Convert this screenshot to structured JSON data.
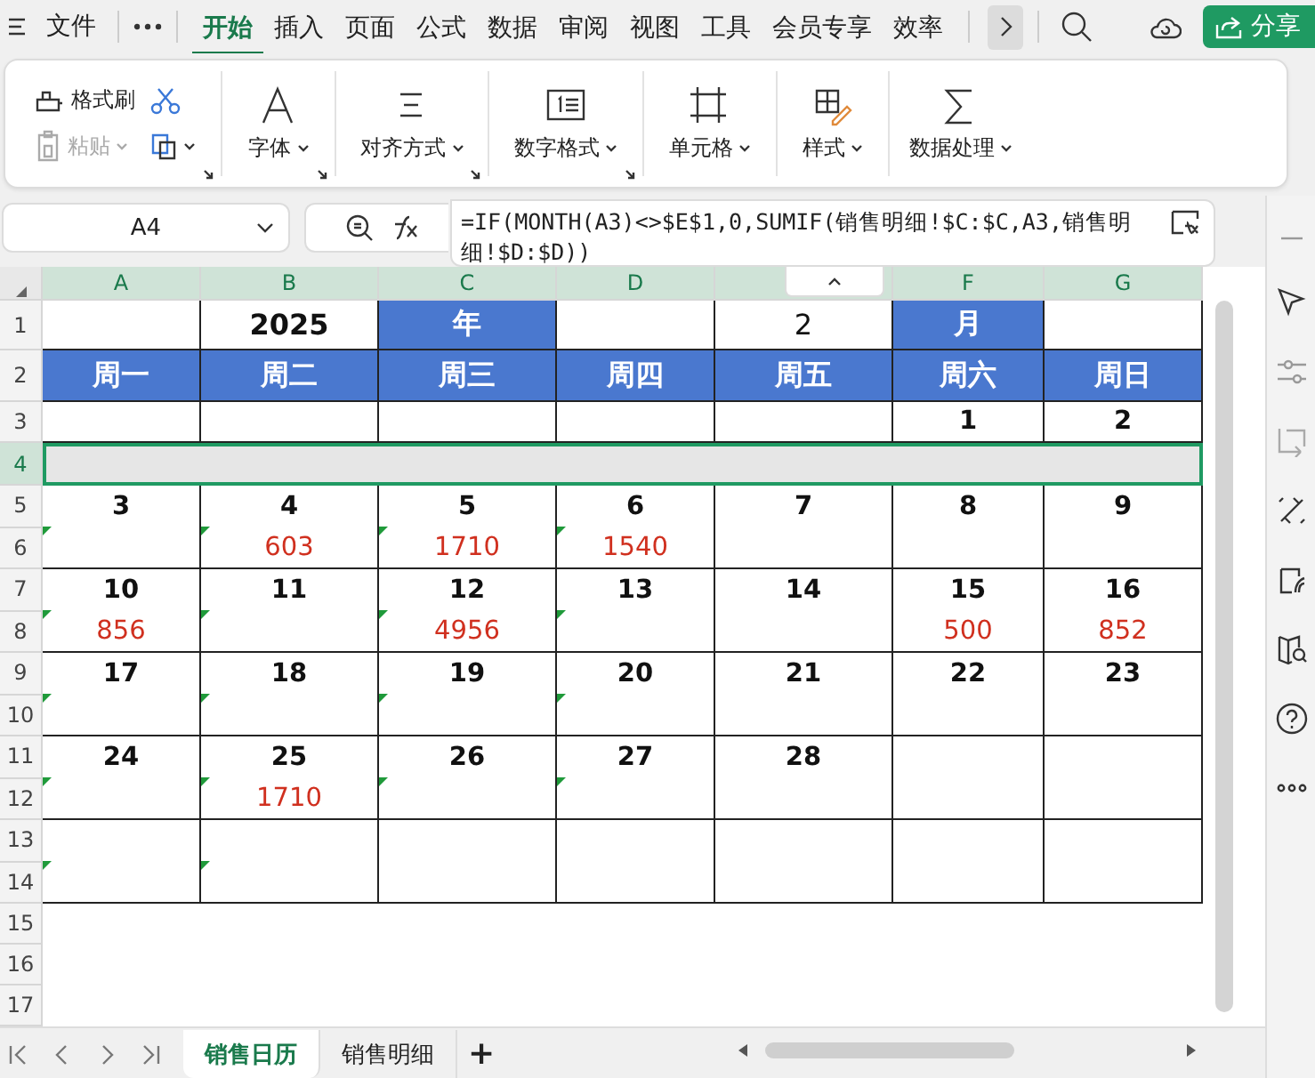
{
  "menubar": {
    "file": "文件",
    "tabs": [
      {
        "label": "开始",
        "selected": true
      },
      {
        "label": "插入",
        "selected": false
      },
      {
        "label": "页面",
        "selected": false
      },
      {
        "label": "公式",
        "selected": false
      },
      {
        "label": "数据",
        "selected": false
      },
      {
        "label": "审阅",
        "selected": false
      },
      {
        "label": "视图",
        "selected": false
      },
      {
        "label": "工具",
        "selected": false
      },
      {
        "label": "会员专享",
        "selected": false
      },
      {
        "label": "效率",
        "selected": false
      }
    ],
    "share": "分享"
  },
  "ribbon": {
    "format_painter": "格式刷",
    "paste": {
      "label": "粘贴",
      "disabled": true
    },
    "groups": [
      {
        "kind": "font",
        "label": "字体",
        "launcher": true
      },
      {
        "kind": "align",
        "label": "对齐方式",
        "launcher": true
      },
      {
        "kind": "number",
        "label": "数字格式",
        "launcher": true
      },
      {
        "kind": "cell",
        "label": "单元格",
        "launcher": false
      },
      {
        "kind": "style",
        "label": "样式",
        "launcher": false
      },
      {
        "kind": "sum",
        "label": "数据处理",
        "launcher": false
      }
    ]
  },
  "formula_bar": {
    "cell": "A4",
    "formula": "=IF(MONTH(A3)<>$E$1,0,SUMIF(销售明细!$C:$C,A3,销售明细!$D:$D))"
  },
  "sheet": {
    "columns": [
      {
        "kind": "header",
        "label": "A"
      },
      {
        "kind": "header",
        "label": "B"
      },
      {
        "kind": "header",
        "label": "C"
      },
      {
        "kind": "header",
        "label": "D"
      },
      {
        "kind": "collapse"
      },
      {
        "kind": "header",
        "label": "F"
      },
      {
        "kind": "header",
        "label": "G"
      }
    ],
    "rows": [
      {
        "label": "1",
        "selected": false
      },
      {
        "label": "2",
        "selected": false
      },
      {
        "label": "3",
        "selected": false
      },
      {
        "label": "4",
        "selected": true
      },
      {
        "label": "5",
        "selected": false
      },
      {
        "label": "6",
        "selected": false
      },
      {
        "label": "7",
        "selected": false
      },
      {
        "label": "8",
        "selected": false
      },
      {
        "label": "9",
        "selected": false
      },
      {
        "label": "10",
        "selected": false
      },
      {
        "label": "11",
        "selected": false
      },
      {
        "label": "12",
        "selected": false
      },
      {
        "label": "13",
        "selected": false
      },
      {
        "label": "14",
        "selected": false
      },
      {
        "label": "15",
        "selected": false
      },
      {
        "label": "16",
        "selected": false
      },
      {
        "label": "17",
        "selected": false
      }
    ],
    "title_cells": [
      {
        "kind": "plain"
      },
      {
        "kind": "bold",
        "text": "2025"
      },
      {
        "kind": "band",
        "text": "年"
      },
      {
        "kind": "plain"
      },
      {
        "kind": "plain",
        "text": "2"
      },
      {
        "kind": "band",
        "text": "月"
      },
      {
        "kind": "plain"
      }
    ],
    "weekdays": [
      "周一",
      "周二",
      "周三",
      "周四",
      "周五",
      "周六",
      "周日"
    ],
    "first_week": [
      {
        "kind": "blank"
      },
      {
        "kind": "blank"
      },
      {
        "kind": "blank"
      },
      {
        "kind": "blank"
      },
      {
        "kind": "blank"
      },
      {
        "kind": "day",
        "date": "1"
      },
      {
        "kind": "day",
        "date": "2"
      }
    ],
    "weeks": [
      {
        "days": [
          {
            "date": "3",
            "flagged": true
          },
          {
            "date": "4",
            "amount": "603",
            "flagged": true
          },
          {
            "date": "5",
            "amount": "1710",
            "flagged": true
          },
          {
            "date": "6",
            "amount": "1540",
            "flagged": true
          },
          {
            "date": "7",
            "flagged": false
          },
          {
            "date": "8",
            "flagged": false
          },
          {
            "date": "9",
            "flagged": false
          }
        ]
      },
      {
        "days": [
          {
            "date": "10",
            "amount": "856",
            "flagged": true
          },
          {
            "date": "11",
            "flagged": true
          },
          {
            "date": "12",
            "amount": "4956",
            "flagged": true
          },
          {
            "date": "13",
            "flagged": true
          },
          {
            "date": "14",
            "flagged": false
          },
          {
            "date": "15",
            "amount": "500",
            "flagged": false
          },
          {
            "date": "16",
            "amount": "852",
            "flagged": false
          }
        ]
      },
      {
        "days": [
          {
            "date": "17",
            "flagged": true
          },
          {
            "date": "18",
            "flagged": true
          },
          {
            "date": "19",
            "flagged": true
          },
          {
            "date": "20",
            "flagged": true
          },
          {
            "date": "21",
            "flagged": false
          },
          {
            "date": "22",
            "flagged": false
          },
          {
            "date": "23",
            "flagged": false
          }
        ]
      },
      {
        "days": [
          {
            "date": "24",
            "flagged": true
          },
          {
            "date": "25",
            "amount": "1710",
            "flagged": true
          },
          {
            "date": "26",
            "flagged": true
          },
          {
            "date": "27",
            "flagged": true
          },
          {
            "date": "28",
            "flagged": false
          },
          {
            "flagged": false
          },
          {
            "flagged": false
          }
        ]
      },
      {
        "days": [
          {
            "flagged": true
          },
          {
            "flagged": true
          },
          {
            "flagged": false
          },
          {
            "flagged": false
          },
          {
            "flagged": false
          },
          {
            "flagged": false
          },
          {
            "flagged": false
          }
        ]
      }
    ]
  },
  "sheet_tabs": [
    {
      "label": "销售日历",
      "selected": true
    },
    {
      "label": "销售明细",
      "selected": false
    }
  ],
  "add_sheet": "+"
}
